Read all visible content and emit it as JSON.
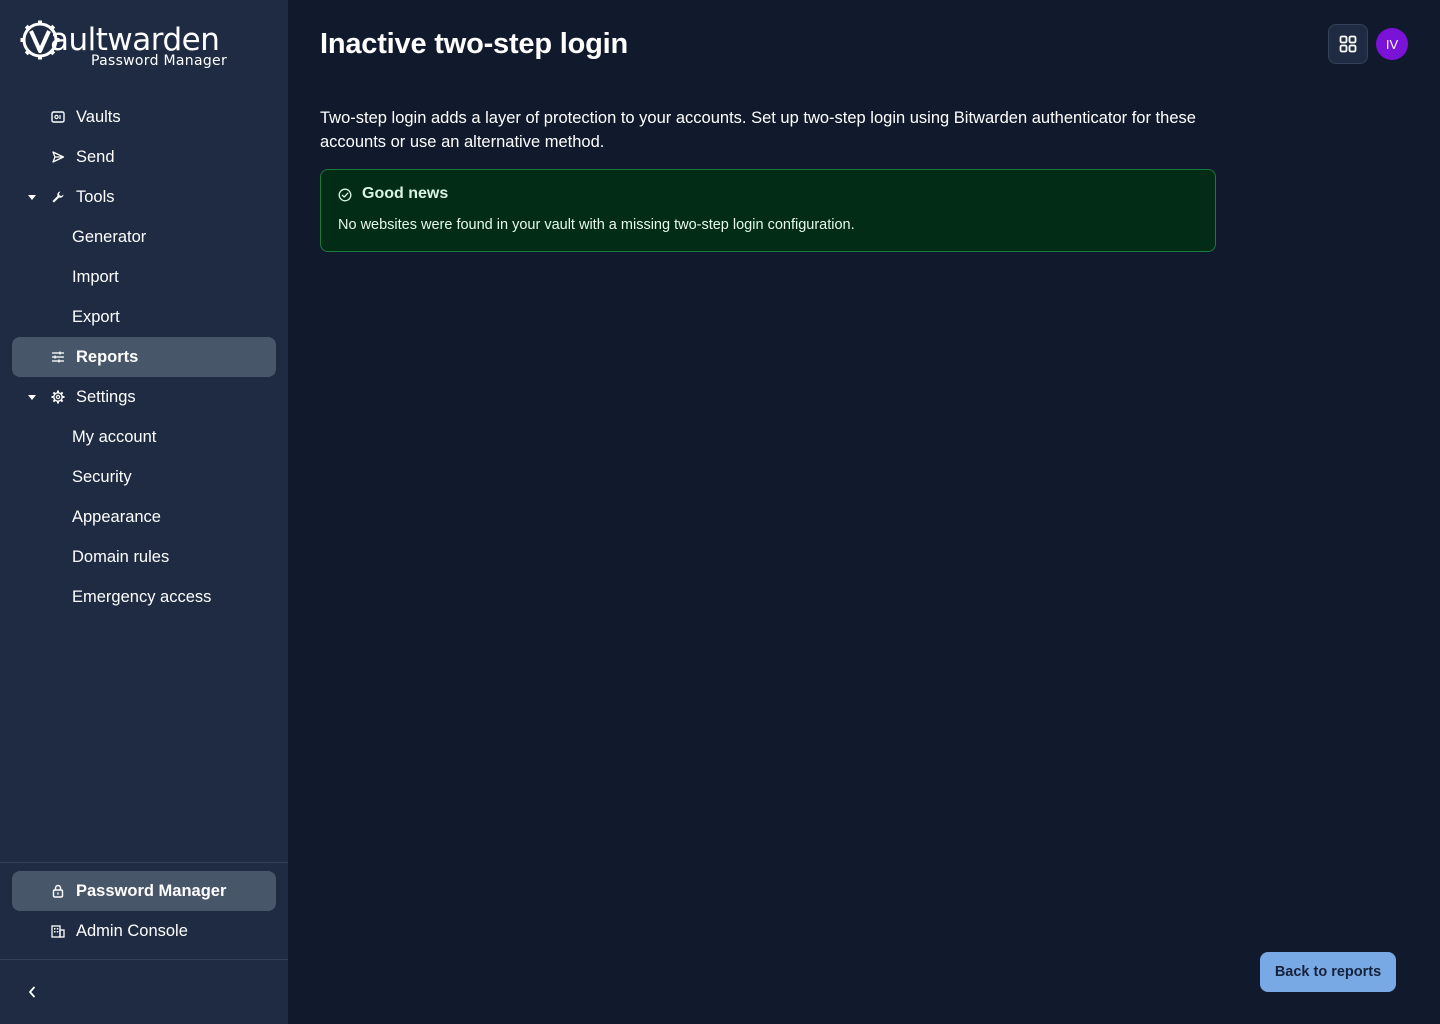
{
  "logo": {
    "wordmark_bold": "V",
    "wordmark_light": "aultwarden",
    "subtitle": "Password Manager"
  },
  "sidebar": {
    "items": [
      {
        "label": "Vaults",
        "icon": "vault-icon"
      },
      {
        "label": "Send",
        "icon": "send-icon"
      },
      {
        "label": "Tools",
        "icon": "wrench-icon",
        "expanded": true
      },
      {
        "label": "Generator"
      },
      {
        "label": "Import"
      },
      {
        "label": "Export"
      },
      {
        "label": "Reports",
        "icon": "sliders-icon",
        "active": true
      },
      {
        "label": "Settings",
        "icon": "gear-icon",
        "expanded": true
      },
      {
        "label": "My account"
      },
      {
        "label": "Security"
      },
      {
        "label": "Appearance"
      },
      {
        "label": "Domain rules"
      },
      {
        "label": "Emergency access"
      }
    ],
    "bottom": [
      {
        "label": "Password Manager",
        "icon": "lock-icon",
        "active": true
      },
      {
        "label": "Admin Console",
        "icon": "building-icon"
      }
    ]
  },
  "header": {
    "title": "Inactive two-step login",
    "avatar_initials": "IV",
    "avatar_color": "#7a12d8"
  },
  "main": {
    "description": "Two-step login adds a layer of protection to your accounts. Set up two-step login using Bitwarden authenticator for these accounts or use an alternative method.",
    "callout": {
      "title": "Good news",
      "text": "No websites were found in your vault with a missing two-step login configuration."
    },
    "back_button": "Back to reports"
  },
  "colors": {
    "background": "#111a2c",
    "sidebar": "#1e2b42",
    "active_item": "#485669",
    "success_bg": "#022c16",
    "success_border": "#1a7a3c",
    "primary_button": "#79a9e5"
  }
}
